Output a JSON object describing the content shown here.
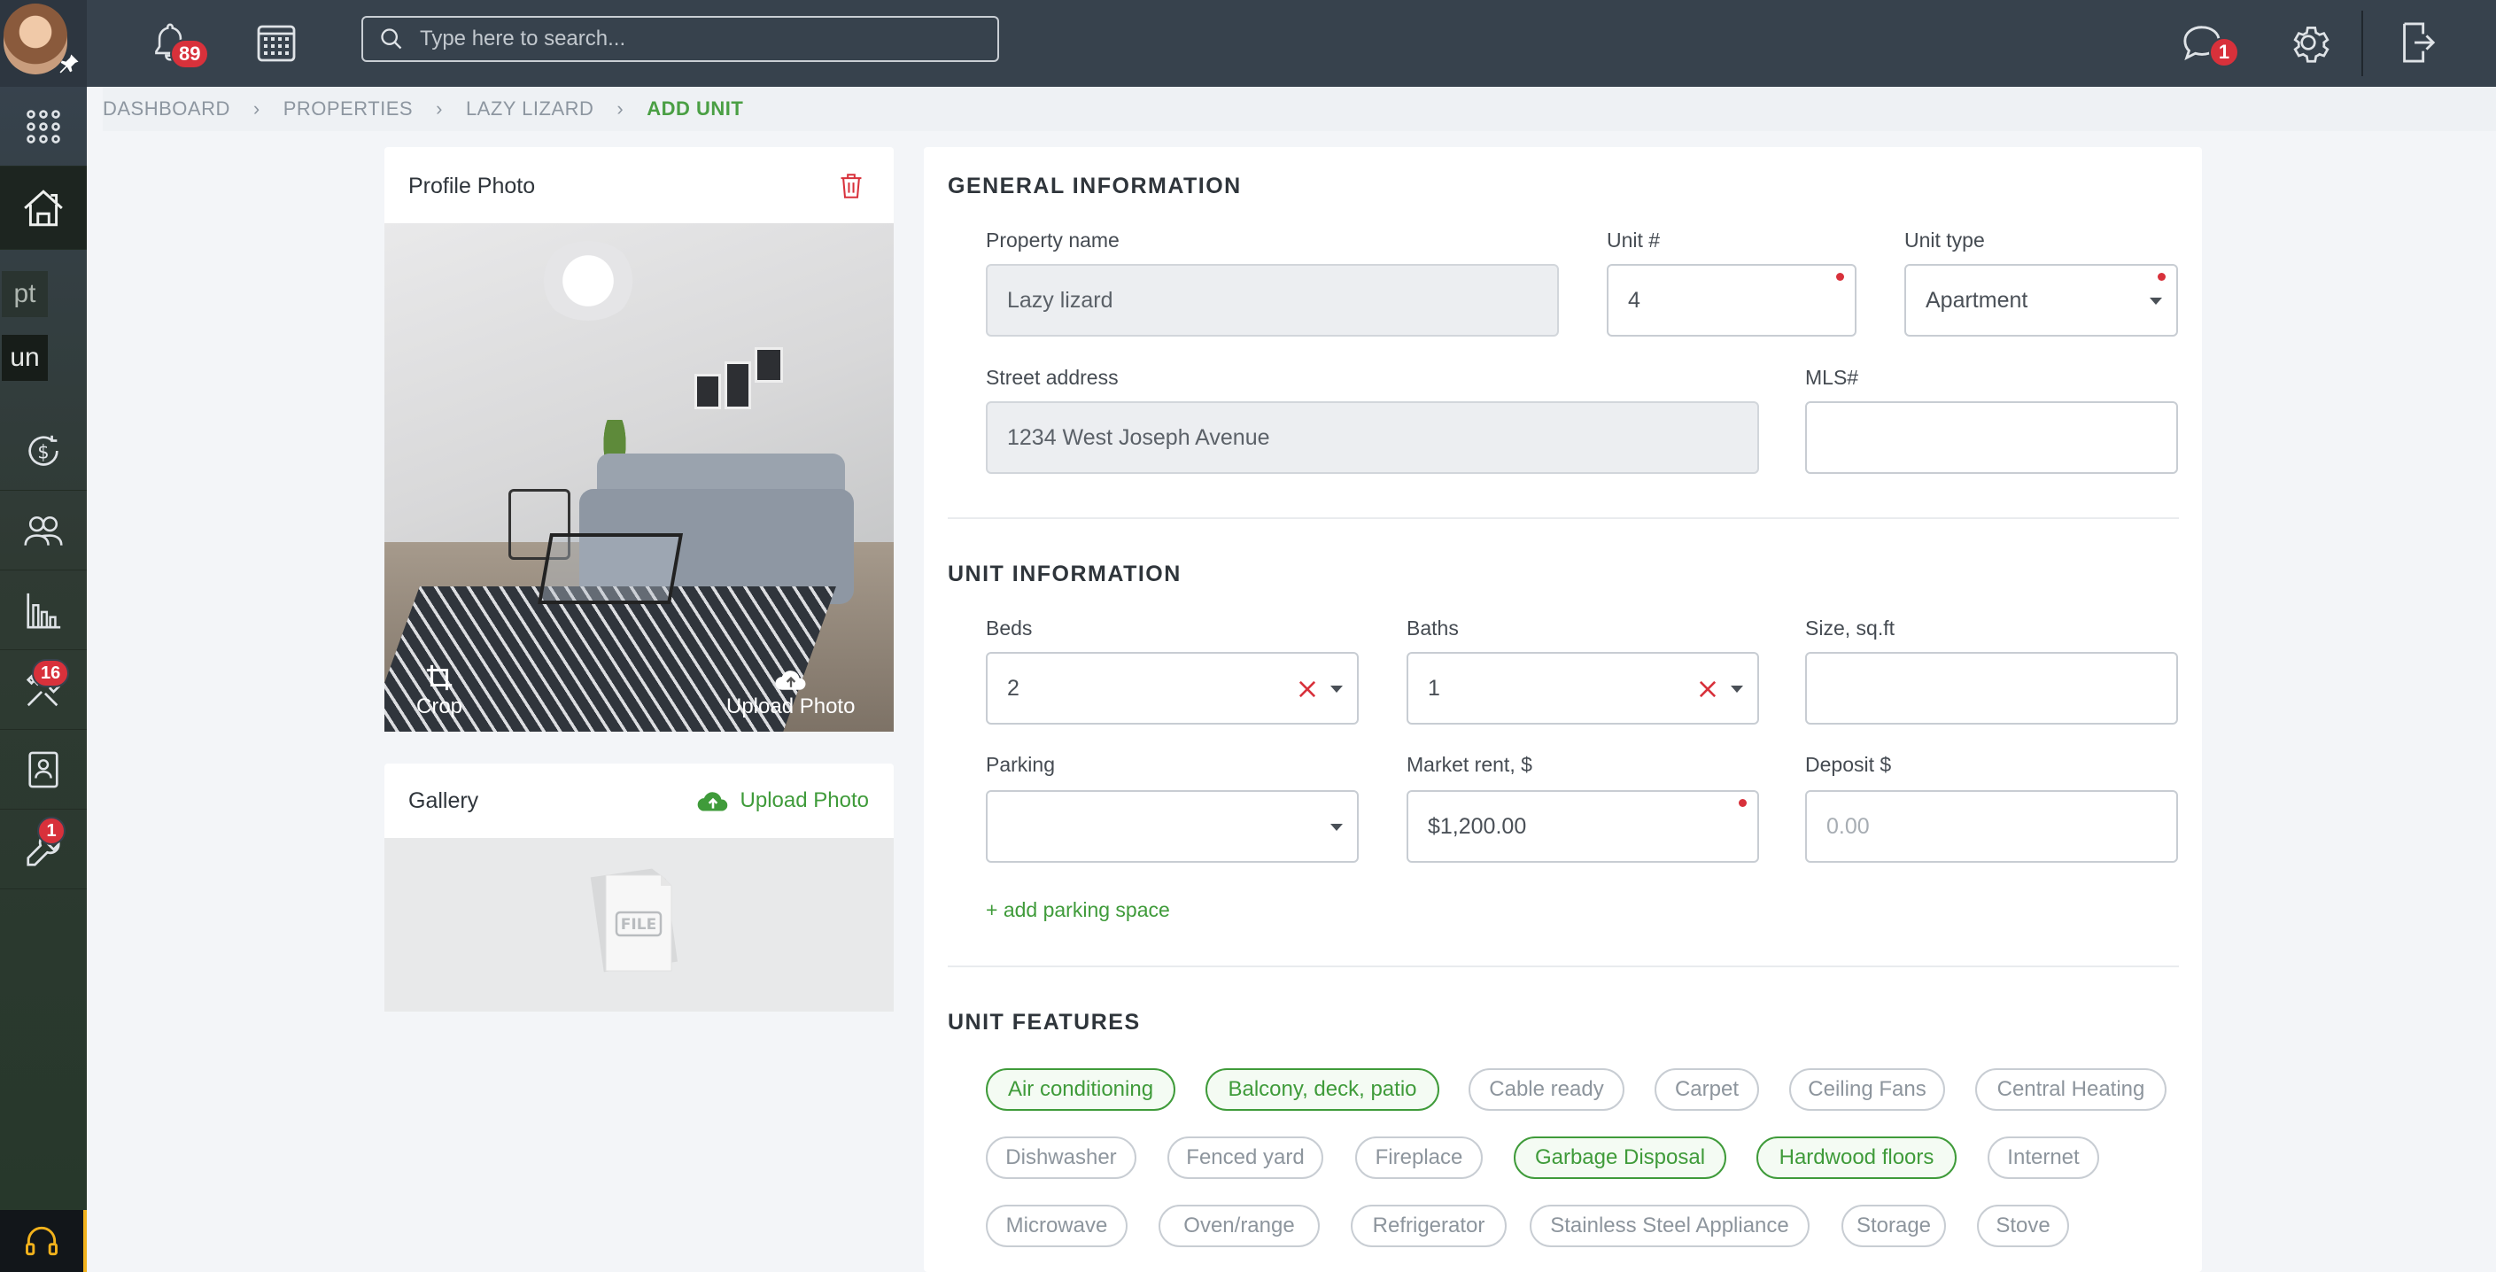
{
  "topbar": {
    "notifications_count": "89",
    "search_placeholder": "Type here to search...",
    "messages_count": "1"
  },
  "sidebar": {
    "chip_pt": "pt",
    "chip_un": "un",
    "maintenance_count": "16",
    "tools_count": "1"
  },
  "breadcrumb": {
    "items": [
      "DASHBOARD",
      "PROPERTIES",
      "LAZY LIZARD"
    ],
    "current": "ADD UNIT"
  },
  "profile_photo": {
    "title": "Profile Photo",
    "crop_label": "Crop",
    "upload_label": "Upload Photo"
  },
  "gallery": {
    "title": "Gallery",
    "upload_label": "Upload Photo",
    "file_icon_text": "FILE"
  },
  "general_info": {
    "title": "GENERAL INFORMATION",
    "property_name_label": "Property name",
    "property_name_value": "Lazy lizard",
    "unit_label": "Unit #",
    "unit_value": "4",
    "unit_type_label": "Unit type",
    "unit_type_value": "Apartment",
    "street_label": "Street address",
    "street_value": "1234 West Joseph Avenue",
    "mls_label": "MLS#",
    "mls_value": ""
  },
  "unit_info": {
    "title": "UNIT INFORMATION",
    "beds_label": "Beds",
    "beds_value": "2",
    "baths_label": "Baths",
    "baths_value": "1",
    "size_label": "Size, sq.ft",
    "size_value": "",
    "parking_label": "Parking",
    "parking_value": "",
    "rent_label": "Market rent, $",
    "rent_value": "$1,200.00",
    "deposit_label": "Deposit $",
    "deposit_placeholder": "0.00",
    "add_parking": "+ add parking space"
  },
  "unit_features": {
    "title": "UNIT FEATURES",
    "items": [
      {
        "label": "Air conditioning",
        "selected": true
      },
      {
        "label": "Balcony, deck, patio",
        "selected": true
      },
      {
        "label": "Cable ready",
        "selected": false
      },
      {
        "label": "Carpet",
        "selected": false
      },
      {
        "label": "Ceiling Fans",
        "selected": false
      },
      {
        "label": "Central Heating",
        "selected": false
      },
      {
        "label": "Dishwasher",
        "selected": false
      },
      {
        "label": "Fenced yard",
        "selected": false
      },
      {
        "label": "Fireplace",
        "selected": false
      },
      {
        "label": "Garbage Disposal",
        "selected": true
      },
      {
        "label": "Hardwood floors",
        "selected": true
      },
      {
        "label": "Internet",
        "selected": false
      },
      {
        "label": "Microwave",
        "selected": false
      },
      {
        "label": "Oven/range",
        "selected": false
      },
      {
        "label": "Refrigerator",
        "selected": false
      },
      {
        "label": "Stainless Steel Appliance",
        "selected": false
      },
      {
        "label": "Storage",
        "selected": false
      },
      {
        "label": "Stove",
        "selected": false
      }
    ]
  },
  "colors": {
    "accent_green": "#3f9b3a",
    "badge_red": "#d8313b",
    "topbar": "#37424d"
  }
}
